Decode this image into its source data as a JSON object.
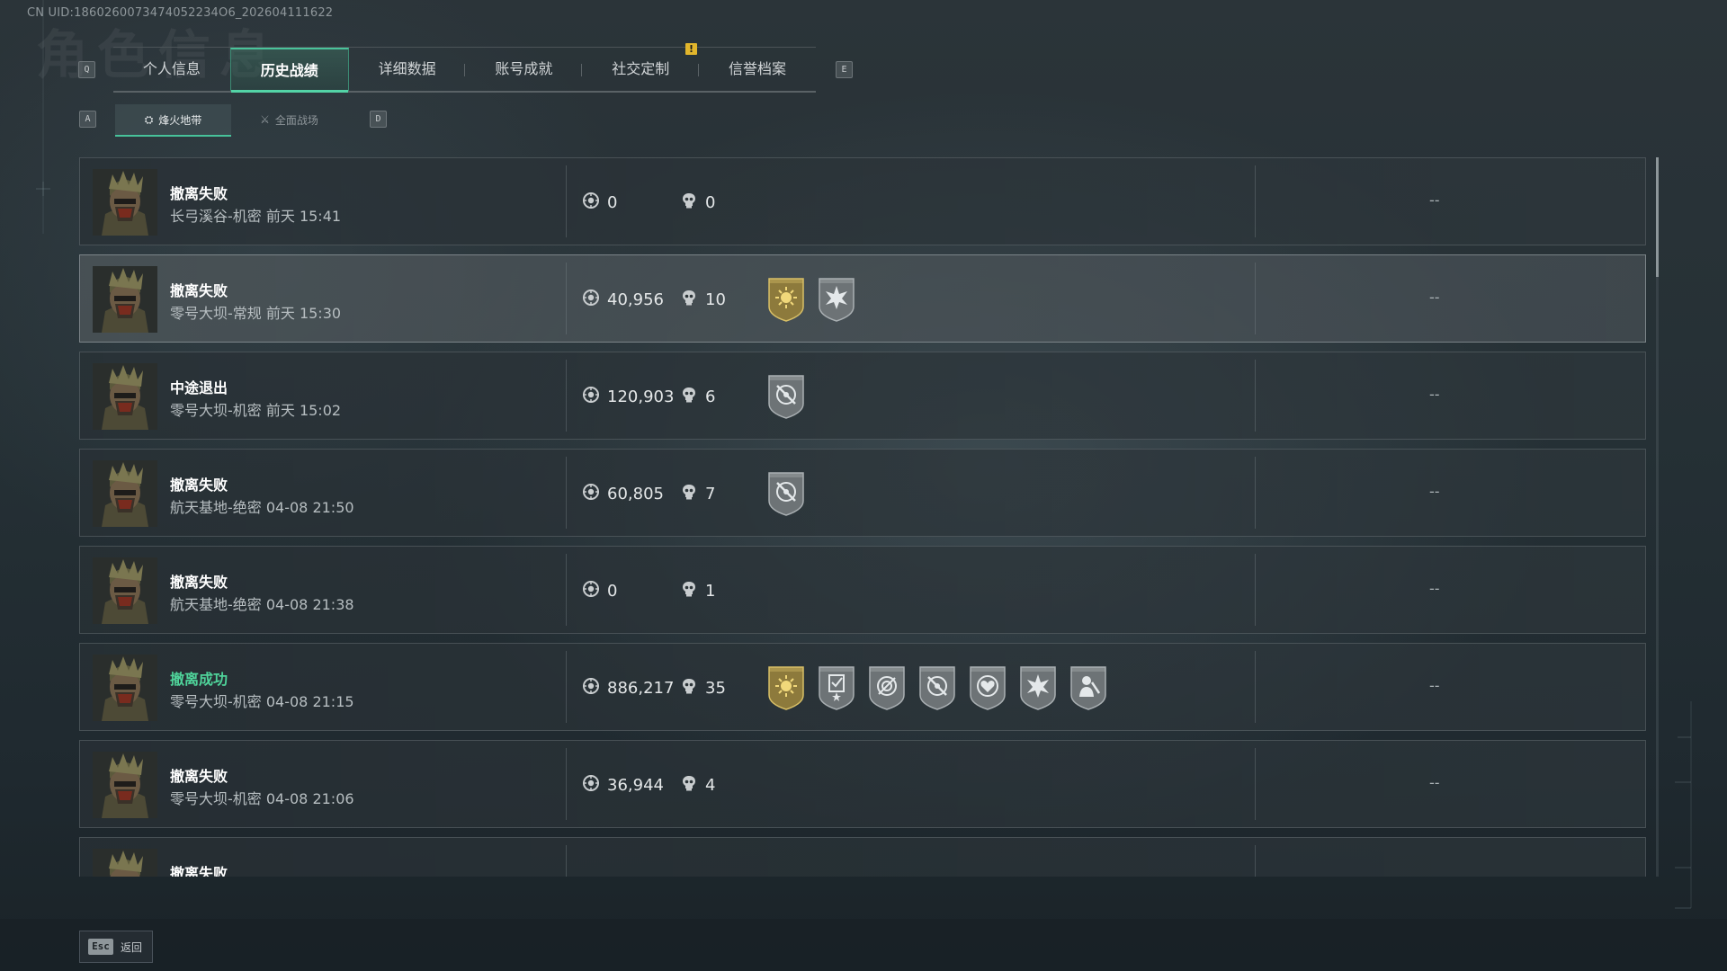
{
  "uid": "CN UID:1860260073474052234O6_202604111622",
  "key_hints": {
    "tab_left": "Q",
    "tab_right": "E",
    "sub_left": "A",
    "sub_right": "D"
  },
  "tabs": [
    {
      "label": "个人信息",
      "active": false
    },
    {
      "label": "历史战绩",
      "active": true
    },
    {
      "label": "详细数据",
      "active": false
    },
    {
      "label": "账号成就",
      "active": false
    },
    {
      "label": "社交定制",
      "active": false
    },
    {
      "label": "信誉档案",
      "active": false
    }
  ],
  "alert_badge": "!",
  "subtabs": [
    {
      "label": "烽火地带",
      "active": true
    },
    {
      "label": "全面战场",
      "active": false
    }
  ],
  "records": [
    {
      "result": "撤离失败",
      "success": false,
      "detail": "长弓溪谷-机密 前天 15:41",
      "value": "0",
      "kills": "0",
      "medals": [],
      "extra": "--"
    },
    {
      "result": "撤离失败",
      "success": false,
      "detail": "零号大坝-常规 前天 15:30",
      "value": "40,956",
      "kills": "10",
      "medals": [
        "gold-sun-medal-icon",
        "silver-star-burst-medal-icon"
      ],
      "extra": "--"
    },
    {
      "result": "中途退出",
      "success": false,
      "detail": "零号大坝-机密 前天 15:02",
      "value": "120,903",
      "kills": "6",
      "medals": [
        "crosshair-medal-icon"
      ],
      "extra": "--"
    },
    {
      "result": "撤离失败",
      "success": false,
      "detail": "航天基地-绝密 04-08 21:50",
      "value": "60,805",
      "kills": "7",
      "medals": [
        "crosshair-medal-icon"
      ],
      "extra": "--"
    },
    {
      "result": "撤离失败",
      "success": false,
      "detail": "航天基地-绝密 04-08 21:38",
      "value": "0",
      "kills": "1",
      "medals": [],
      "extra": "--"
    },
    {
      "result": "撤离成功",
      "success": true,
      "detail": "零号大坝-机密 04-08 21:15",
      "value": "886,217",
      "kills": "35",
      "medals": [
        "gold-sun-medal-icon",
        "checklist-star-medal-icon",
        "target-medal-icon",
        "crosshair-medal-icon",
        "heart-target-medal-icon",
        "silver-star-burst-medal-icon",
        "soldier-medal-icon"
      ],
      "extra": "--"
    },
    {
      "result": "撤离失败",
      "success": false,
      "detail": "零号大坝-机密 04-08 21:06",
      "value": "36,944",
      "kills": "4",
      "medals": [],
      "extra": "--"
    },
    {
      "result": "撤离失败",
      "success": false,
      "detail": "",
      "value": "",
      "kills": "",
      "medals": [],
      "extra": ""
    }
  ],
  "footer": {
    "esc_key": "Esc",
    "back_label": "返回"
  },
  "colors": {
    "accent": "#53d3a6",
    "success": "#4fd39a",
    "alert": "#e2b62c"
  }
}
